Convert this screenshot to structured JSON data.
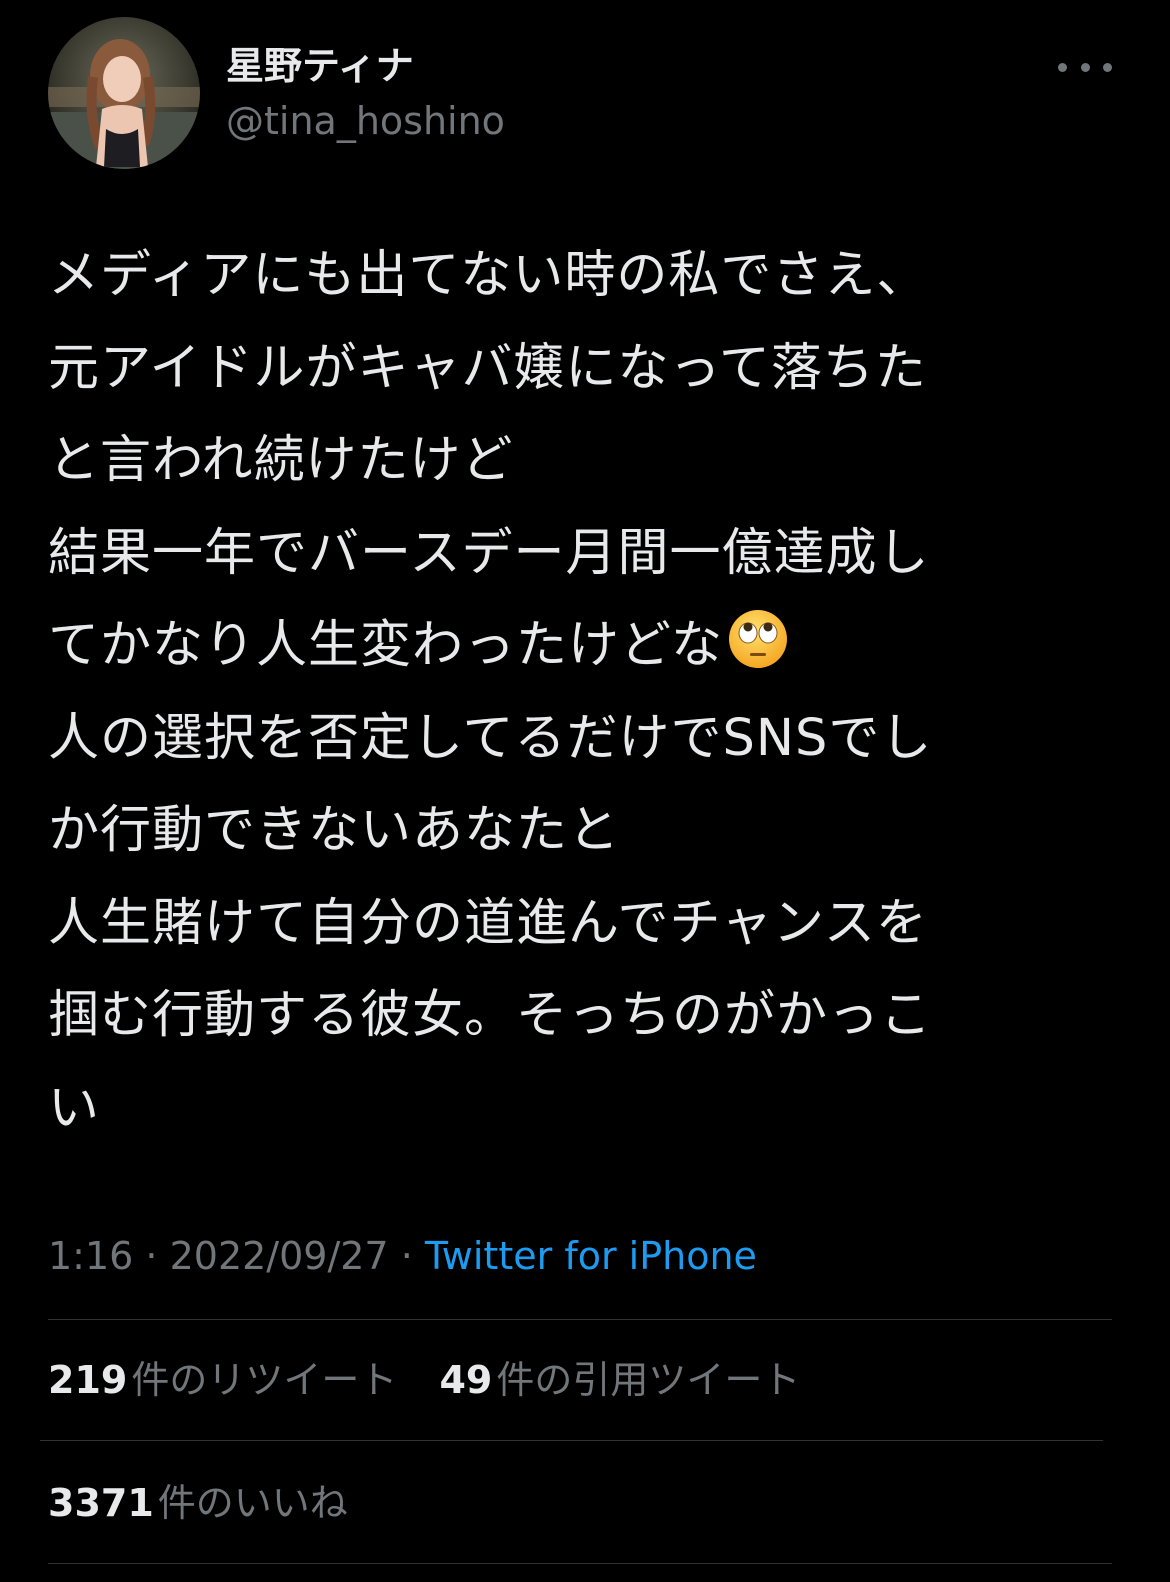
{
  "user": {
    "display_name": "星野ティナ",
    "handle": "@tina_hoshino"
  },
  "tweet": {
    "lines": [
      "メディアにも出てない時の私でさえ、",
      "元アイドルがキャバ嬢になって落ちた",
      "と言われ続けたけど",
      "結果一年でバースデー月間一億達成し",
      "てかなり人生変わったけどな",
      "人の選択を否定してるだけでSNSでし",
      "か行動できないあなたと",
      "人生賭けて自分の道進んでチャンスを",
      "掴む行動する彼女。そっちのがかっこ",
      "い"
    ],
    "emoji": "face-with-rolling-eyes"
  },
  "meta": {
    "time": "1:16",
    "separator": " · ",
    "date": "2022/09/27",
    "source": "Twitter for iPhone"
  },
  "stats": {
    "retweets_count": "219",
    "retweets_label": "件のリツイート",
    "quotes_count": "49",
    "quotes_label": "件の引用ツイート",
    "likes_count": "3371",
    "likes_label": "件のいいね"
  },
  "colors": {
    "background": "#000000",
    "text": "#e7e9ea",
    "secondary": "#71767b",
    "link": "#1d9bf0",
    "divider": "#2f3336"
  }
}
